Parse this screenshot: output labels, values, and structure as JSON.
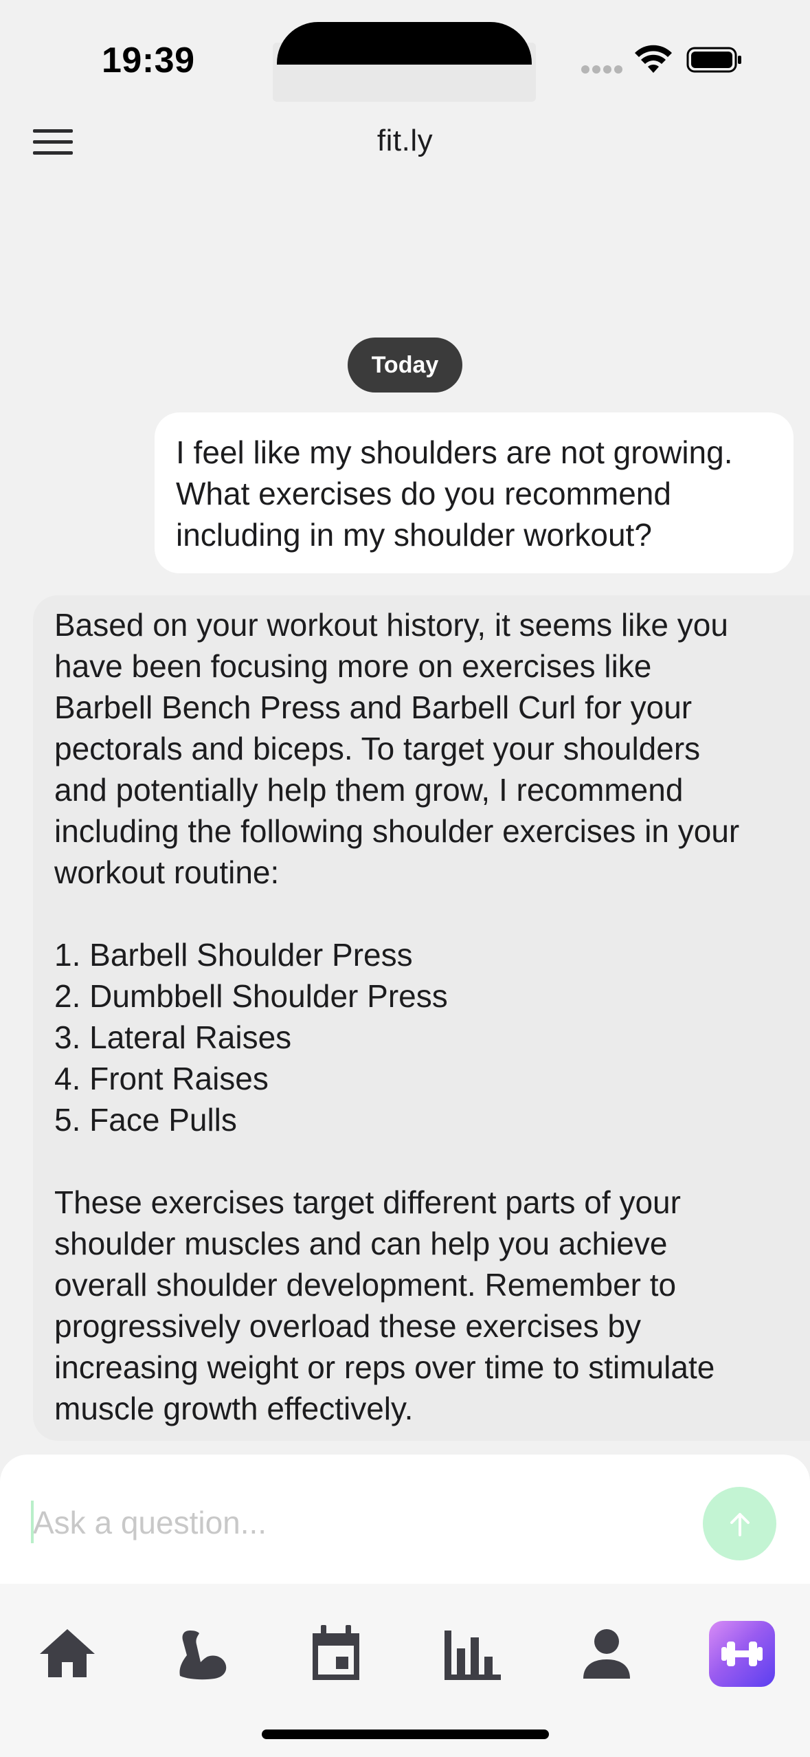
{
  "status_bar": {
    "time": "19:39",
    "icons": [
      "cellular-signal-icon",
      "wifi-icon",
      "battery-icon"
    ]
  },
  "header": {
    "title": "fit.ly",
    "menu_icon": "hamburger-menu-icon"
  },
  "chat": {
    "date_label": "Today",
    "messages": [
      {
        "role": "user",
        "text": "I feel like my shoulders are not growing.\nWhat exercises do you recommend\nincluding in my shoulder workout?"
      },
      {
        "role": "assistant",
        "text": "Based on your workout history, it seems like you\nhave been focusing more on exercises like\nBarbell Bench Press and Barbell Curl for your\npectorals and biceps. To target your shoulders\nand potentially help them grow, I recommend\nincluding the following shoulder exercises in your\nworkout routine:\n\n1. Barbell Shoulder Press\n2. Dumbbell Shoulder Press\n3. Lateral Raises\n4. Front Raises\n5. Face Pulls\n\nThese exercises target different parts of your\nshoulder muscles and can help you achieve\noverall shoulder development. Remember to\nprogressively overload these exercises by\nincreasing weight or reps over time to stimulate\nmuscle growth effectively."
      }
    ]
  },
  "composer": {
    "placeholder": "Ask a question...",
    "value": "",
    "send_icon": "arrow-up-icon"
  },
  "tab_bar": {
    "items": [
      {
        "icon": "home-icon"
      },
      {
        "icon": "bicep-icon"
      },
      {
        "icon": "calendar-icon"
      },
      {
        "icon": "bar-chart-icon"
      },
      {
        "icon": "person-icon"
      },
      {
        "icon": "dumbbell-icon",
        "active": true
      }
    ]
  },
  "colors": {
    "background": "#f1f1f1",
    "user_bubble": "#ffffff",
    "assistant_bubble": "#ebebeb",
    "date_pill": "#3b3b3b",
    "send_button": "#c3f4d3",
    "tab_icon": "#3f3f46",
    "active_tab_gradient": [
      "#d88cf5",
      "#9a5cf0",
      "#5b3ff0"
    ]
  }
}
